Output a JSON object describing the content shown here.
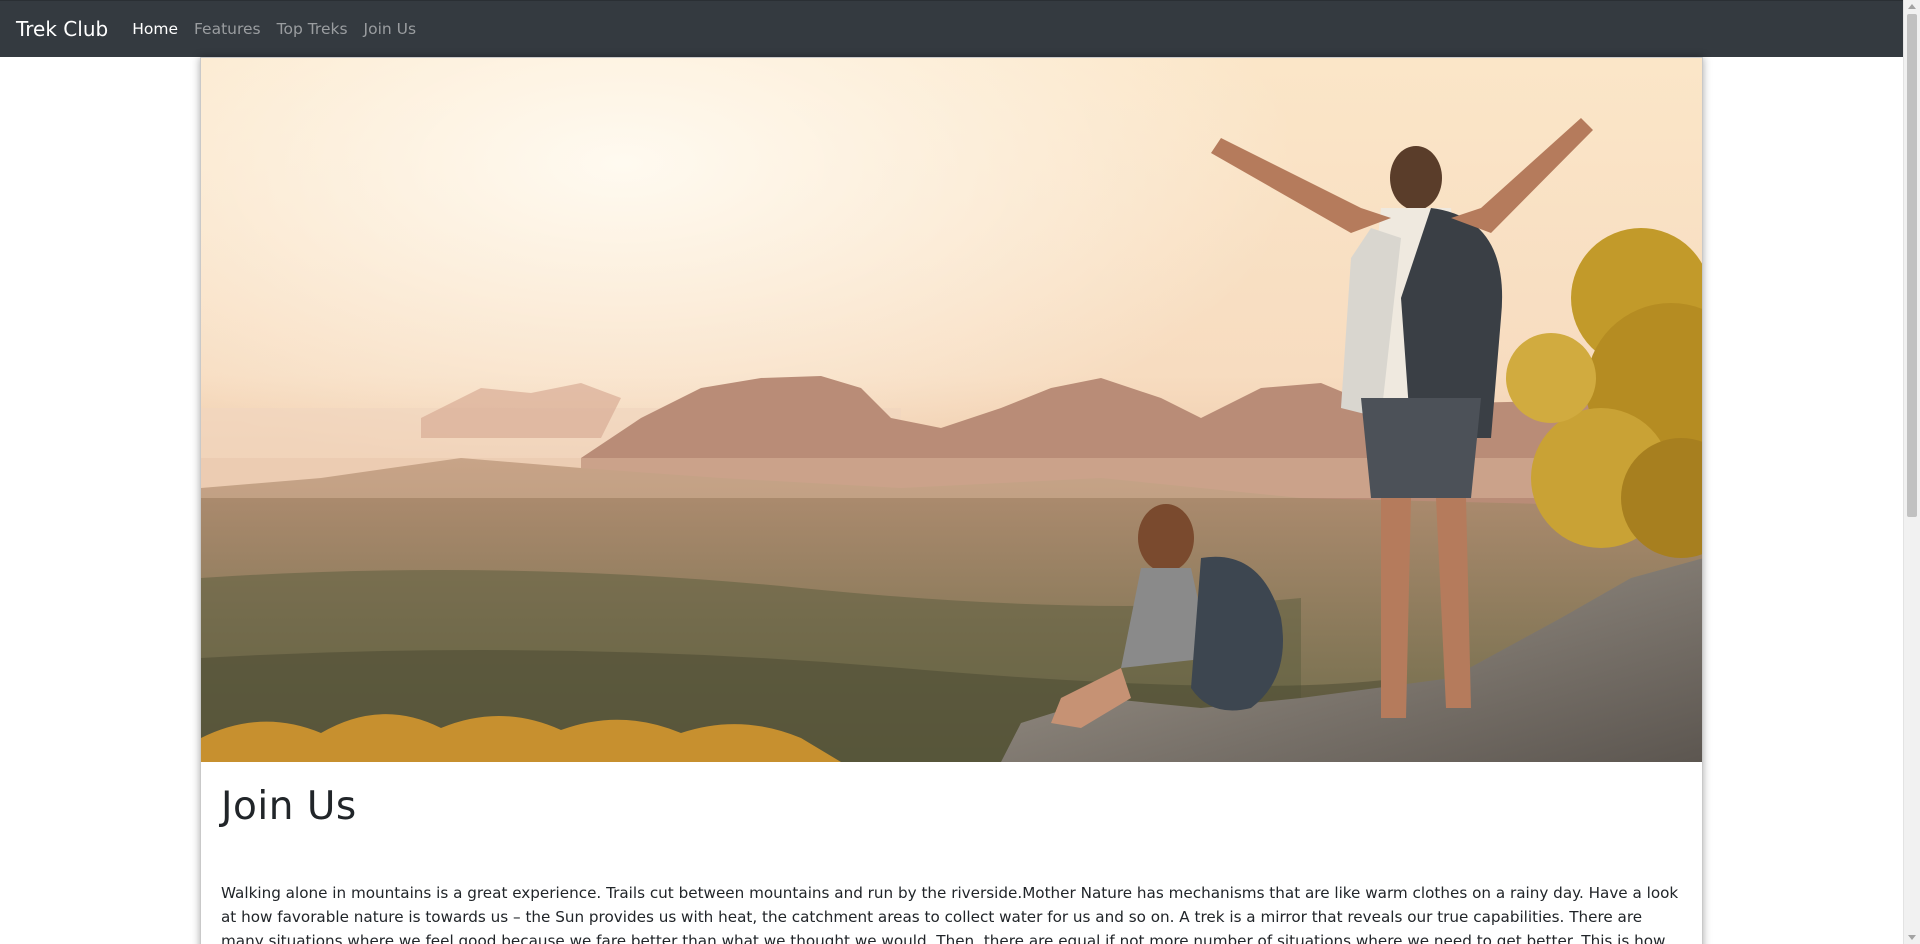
{
  "navbar": {
    "brand": "Trek Club",
    "links": [
      {
        "label": "Home",
        "active": true
      },
      {
        "label": "Features",
        "active": false
      },
      {
        "label": "Top Treks",
        "active": false
      },
      {
        "label": "Join Us",
        "active": false
      }
    ]
  },
  "card": {
    "image_alt": "Two hikers with backpacks on a mountain summit overlooking a valley at sunrise",
    "title": "Join Us",
    "text": "Walking alone in mountains is a great experience. Trails cut between mountains and run by the riverside.Mother Nature has mechanisms that are like warm clothes on a rainy day. Have a look at how favorable nature is towards us – the Sun provides us with heat, the catchment areas to collect water for us and so on. A trek is a mirror that reveals our true capabilities. There are many situations where we feel good because we fare better than what we thought we would. Then, there are equal if not more number of situations where we need to get better. This is how personality development begins from deep within."
  },
  "colors": {
    "navbar_bg": "#343a40",
    "nav_active": "#ffffff",
    "nav_inactive": "#9a9da0",
    "text": "#212529"
  }
}
